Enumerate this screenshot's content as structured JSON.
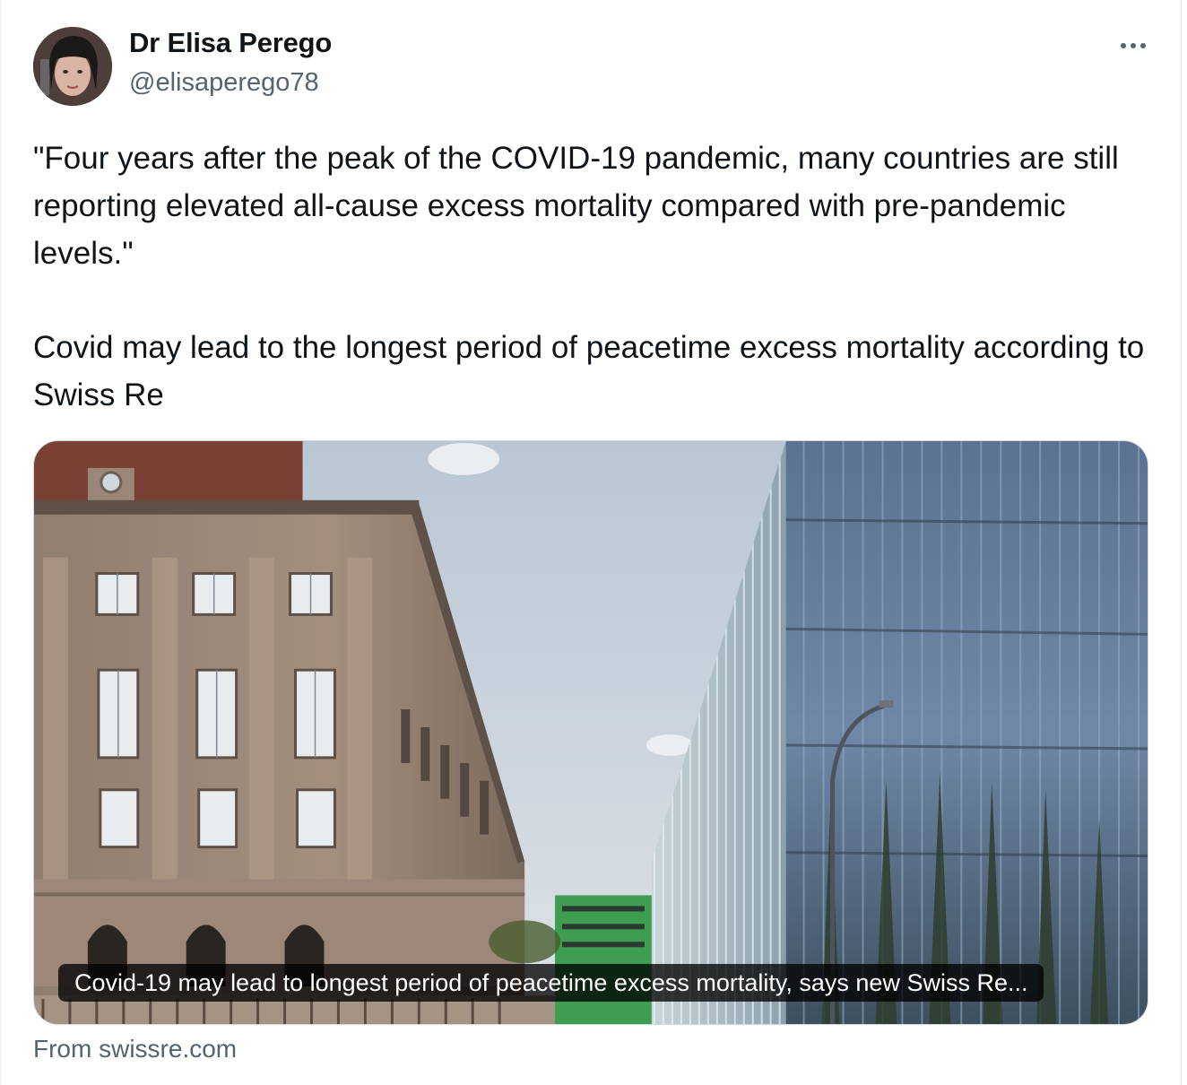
{
  "author": {
    "name": "Dr Elisa Perego",
    "handle": "@elisaperego78"
  },
  "tweet": {
    "paragraphs": [
      "\"Four years after the peak of the COVID-19 pandemic, many countries are still reporting elevated all-cause excess mortality compared with pre-pandemic levels.\"",
      "Covid may lead to the longest period of peacetime excess mortality according to Swiss Re"
    ]
  },
  "card": {
    "caption": "Covid-19 may lead to longest period of peacetime excess mortality, says new Swiss Re...",
    "image": "stone-building-and-glass-building-photo"
  },
  "source": {
    "label": "From swissre.com"
  },
  "icons": {
    "more": "more-options-icon"
  }
}
